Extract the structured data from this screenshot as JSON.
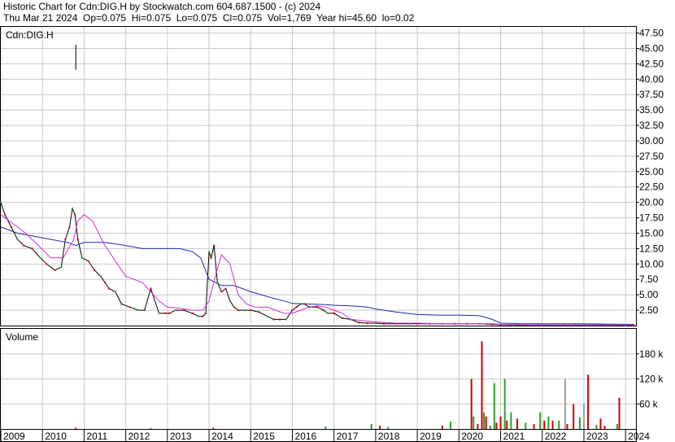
{
  "header": {
    "title": "Historic Chart for Cdn:DIG.H by Stockwatch.com 604.687.1500 - (c) 2024",
    "quote_line": "Thu Mar 21 2024  Op=0.075  Hi=0.075  Lo=0.075  Cl=0.075  Vol=1,769  Year hi=45.60  lo=0.02"
  },
  "price_panel": {
    "label": "Cdn:DIG.H"
  },
  "volume_panel": {
    "label": "Volume"
  },
  "chart_data": {
    "type": "line",
    "title": "Historic Chart for Cdn:DIG.H",
    "price_axis": {
      "ticks": [
        "47.50",
        "45.00",
        "42.50",
        "40.00",
        "37.50",
        "35.00",
        "32.50",
        "30.00",
        "27.50",
        "25.00",
        "22.50",
        "20.00",
        "17.50",
        "15.00",
        "12.50",
        "10.00",
        "7.50",
        "5.00",
        "2.50"
      ],
      "ylim": [
        0,
        48.5
      ]
    },
    "volume_axis": {
      "ticks": [
        "180 k",
        "120 k",
        "60 k"
      ],
      "ylim": [
        0,
        240000
      ]
    },
    "x_axis": {
      "ticks": [
        "2009",
        "2010",
        "2011",
        "2012",
        "2013",
        "2014",
        "2015",
        "2016",
        "2017",
        "2018",
        "2019",
        "2020",
        "2021",
        "2022",
        "2023",
        "2024"
      ],
      "xlim": [
        2009.0,
        2024.25
      ]
    },
    "series": [
      {
        "style": "close",
        "x": [
          2009.0,
          2009.1,
          2009.25,
          2009.4,
          2009.55,
          2009.75,
          2009.95,
          2010.1,
          2010.3,
          2010.45,
          2010.55,
          2010.65,
          2010.72,
          2010.78,
          2010.85,
          2010.95,
          2011.1,
          2011.25,
          2011.4,
          2011.5,
          2011.6,
          2011.75,
          2011.9,
          2012.1,
          2012.3,
          2012.45,
          2012.6,
          2012.8,
          2012.95,
          2013.05,
          2013.2,
          2013.4,
          2013.6,
          2013.75,
          2013.85,
          2013.92,
          2014.0,
          2014.05,
          2014.12,
          2014.2,
          2014.3,
          2014.4,
          2014.5,
          2014.6,
          2014.7,
          2014.85,
          2015.0,
          2015.2,
          2015.4,
          2015.55,
          2015.7,
          2015.85,
          2016.0,
          2016.1,
          2016.2,
          2016.3,
          2016.4,
          2016.5,
          2016.6,
          2016.75,
          2016.85,
          2017.0,
          2017.2,
          2017.4,
          2017.6,
          2017.8,
          2018.0,
          2018.2,
          2018.5,
          2018.8,
          2019.0,
          2019.3,
          2019.6,
          2019.9,
          2020.2,
          2020.5,
          2020.8,
          2021.0,
          2021.3,
          2021.6,
          2021.9,
          2022.2,
          2022.5,
          2022.8,
          2023.1,
          2023.4,
          2023.7,
          2024.0,
          2024.2
        ],
        "y": [
          20,
          18,
          16,
          14,
          13,
          12.5,
          11,
          10,
          9,
          9.5,
          14,
          16,
          19,
          18,
          14,
          11,
          10.5,
          9,
          8,
          7,
          6,
          5.5,
          3.5,
          3,
          2.5,
          2.5,
          6,
          2,
          2,
          2,
          2.5,
          2.5,
          2,
          1.5,
          1.5,
          2,
          12,
          11,
          13,
          7,
          5.5,
          6,
          4,
          3,
          2.5,
          2.5,
          2.5,
          2.2,
          1.5,
          1,
          1,
          1,
          2.5,
          3,
          3.5,
          3.5,
          3,
          3,
          3,
          2.5,
          2,
          2,
          1.2,
          1,
          0.5,
          0.4,
          0.4,
          0.3,
          0.3,
          0.3,
          0.3,
          0.3,
          0.3,
          0.3,
          0.3,
          0.3,
          0.2,
          0.15,
          0.1,
          0.1,
          0.1,
          0.1,
          0.1,
          0.1,
          0.1,
          0.1,
          0.1,
          0.075,
          0.075
        ]
      },
      {
        "name": "",
        "style": "avg-long",
        "color": "#1f2aa8",
        "x": [
          2009.0,
          2009.4,
          2009.8,
          2010.2,
          2010.6,
          2010.8,
          2011.0,
          2011.5,
          2012.0,
          2012.4,
          2012.8,
          2013.0,
          2013.3,
          2013.6,
          2013.8,
          2014.0,
          2014.3,
          2014.6,
          2015.0,
          2015.4,
          2015.8,
          2016.0,
          2016.4,
          2016.8,
          2017.0,
          2017.4,
          2017.8,
          2018.0,
          2018.5,
          2019.0,
          2019.5,
          2020.0,
          2020.5,
          2020.8,
          2021.0,
          2021.5,
          2022.0,
          2022.5,
          2023.0,
          2023.5,
          2024.2
        ],
        "y": [
          16,
          15,
          14.5,
          14,
          13.5,
          13,
          13.5,
          13.5,
          13,
          12.5,
          12.5,
          12.5,
          12.5,
          12,
          11,
          7.5,
          6.5,
          6.5,
          5.5,
          4.7,
          4,
          3.6,
          3.5,
          3.4,
          3.3,
          3.2,
          3,
          2.7,
          2.2,
          1.8,
          1.7,
          1.7,
          1.6,
          1,
          0.4,
          0.3,
          0.3,
          0.3,
          0.3,
          0.25,
          0.2
        ]
      },
      {
        "name": "",
        "style": "avg-short",
        "color": "#d22fd2",
        "x": [
          2009.0,
          2009.3,
          2009.6,
          2009.9,
          2010.2,
          2010.5,
          2010.75,
          2010.85,
          2011.0,
          2011.2,
          2011.5,
          2011.8,
          2012.0,
          2012.4,
          2012.6,
          2012.8,
          2013.0,
          2013.3,
          2013.6,
          2013.85,
          2014.0,
          2014.15,
          2014.3,
          2014.5,
          2014.7,
          2014.9,
          2015.1,
          2015.4,
          2015.6,
          2015.8,
          2016.0,
          2016.2,
          2016.4,
          2016.6,
          2016.8,
          2017.0,
          2017.2,
          2017.4,
          2017.7,
          2018.0,
          2018.5,
          2019.0,
          2019.5,
          2020.0,
          2020.5,
          2020.8,
          2021.0,
          2022.0,
          2023.0,
          2024.2
        ],
        "y": [
          18,
          16.5,
          15,
          13,
          11,
          11,
          14,
          17,
          18,
          17,
          13,
          10,
          8,
          7,
          5.5,
          4,
          3,
          2.8,
          2.5,
          2.5,
          4,
          8,
          11.5,
          10,
          5,
          3.5,
          3,
          3,
          2.5,
          2,
          2,
          2.5,
          3,
          3.2,
          3,
          2.5,
          2,
          1,
          0.8,
          0.6,
          0.4,
          0.4,
          0.3,
          0.3,
          0.3,
          0.3,
          0.2,
          0.1,
          0.1,
          0.1
        ]
      }
    ],
    "volume": {
      "x": [
        2010.8,
        2012.6,
        2014.1,
        2016.8,
        2017.9,
        2018.1,
        2018.3,
        2019.6,
        2019.8,
        2020.3,
        2020.35,
        2020.45,
        2020.55,
        2020.6,
        2020.65,
        2020.75,
        2020.85,
        2020.9,
        2021.0,
        2021.1,
        2021.15,
        2021.25,
        2021.4,
        2021.6,
        2021.8,
        2021.95,
        2022.05,
        2022.15,
        2022.25,
        2022.4,
        2022.55,
        2022.6,
        2022.75,
        2022.9,
        2023.0,
        2023.1,
        2023.3,
        2023.4,
        2023.5,
        2023.8,
        2023.85
      ],
      "y": [
        3000,
        2500,
        3000,
        6000,
        12000,
        8000,
        5000,
        8000,
        18000,
        120000,
        30000,
        12000,
        210000,
        40000,
        30000,
        8000,
        110000,
        15000,
        30000,
        120000,
        20000,
        40000,
        25000,
        15000,
        12000,
        40000,
        20000,
        30000,
        20000,
        20000,
        120000,
        12000,
        60000,
        28000,
        60000,
        130000,
        10000,
        25000,
        8000,
        12000,
        75000
      ],
      "colors": [
        "#d00000",
        "#2e9e2e",
        "#d00000",
        "#2e9e2e",
        "#2e9e2e",
        "#d00000",
        "#2e9e2e",
        "#d00000",
        "#2e9e2e",
        "#d00000",
        "#2e9e2e",
        "#d00000",
        "#d00000",
        "#2e9e2e",
        "#d00000",
        "#2e9e2e",
        "#2e9e2e",
        "#d00000",
        "#d00000",
        "#2e9e2e",
        "#d00000",
        "#2e9e2e",
        "#d00000",
        "#2e9e2e",
        "#d00000",
        "#2e9e2e",
        "#d00000",
        "#2e9e2e",
        "#d00000",
        "#2e9e2e",
        "#a0a0a0",
        "#d00000",
        "#d00000",
        "#2e9e2e",
        "#a0a0a0",
        "#d00000",
        "#2e9e2e",
        "#d00000",
        "#d00000",
        "#2e9e2e",
        "#d00000"
      ]
    }
  },
  "colors": {
    "up": "#d00000",
    "down": "#2e9e2e",
    "price_line": "#000000",
    "avg_long": "#1f2aa8",
    "avg_short": "#d22fd2",
    "grid": "#c8c8c8"
  }
}
